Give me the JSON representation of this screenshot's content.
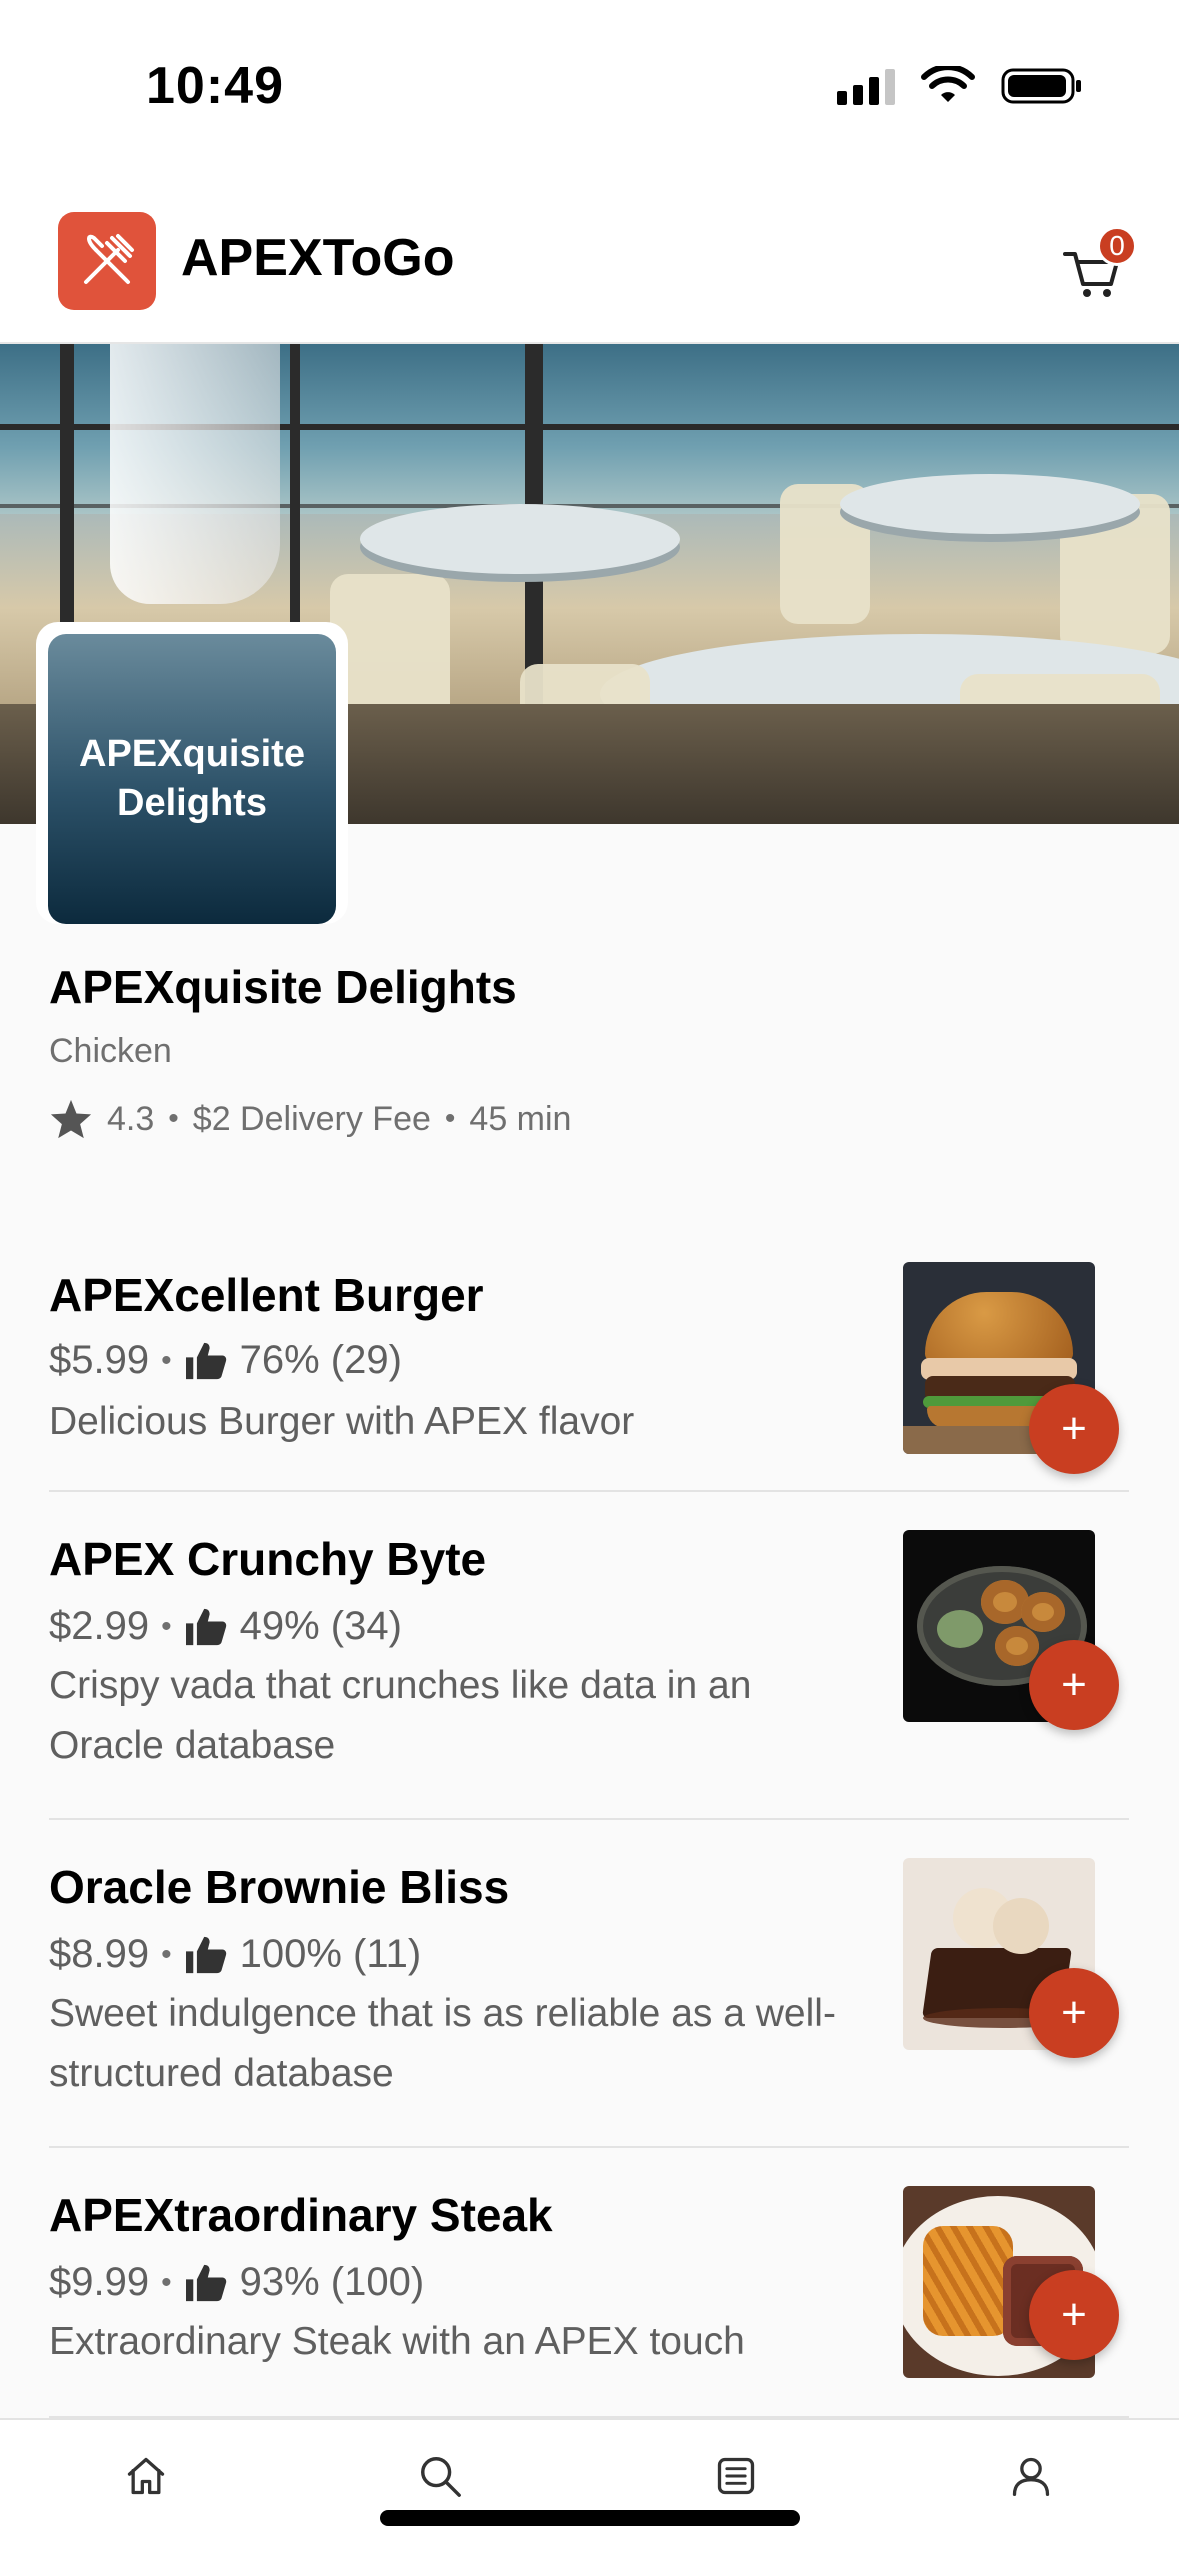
{
  "status_bar": {
    "time": "10:49"
  },
  "header": {
    "title": "APEXToGo",
    "cart_count": "0"
  },
  "restaurant": {
    "logo_text": "APEXquisite Delights",
    "name": "APEXquisite Delights",
    "category": "Chicken",
    "rating": "4.3",
    "delivery_fee": "$2 Delivery Fee",
    "delivery_time": "45 min"
  },
  "menu_items": [
    {
      "name": "APEXcellent Burger",
      "price": "$5.99",
      "rating": "76% (29)",
      "description": "Delicious Burger with APEX flavor",
      "add_label": "+",
      "image": "burger"
    },
    {
      "name": "APEX Crunchy Byte",
      "price": "$2.99",
      "rating": "49% (34)",
      "description": "Crispy vada that crunches like data in an Oracle database",
      "add_label": "+",
      "image": "vada"
    },
    {
      "name": "Oracle Brownie Bliss",
      "price": "$8.99",
      "rating": "100% (11)",
      "description": "Sweet indulgence that is as reliable as a well-structured database",
      "add_label": "+",
      "image": "brownie"
    },
    {
      "name": "APEXtraordinary Steak",
      "price": "$9.99",
      "rating": "93% (100)",
      "description": "Extraordinary Steak with an APEX touch",
      "add_label": "+",
      "image": "steak"
    }
  ],
  "bottom_nav": [
    "home-icon",
    "search-icon",
    "orders-icon",
    "profile-icon"
  ],
  "colors": {
    "accent": "#c93e21",
    "logo": "#e0533b"
  }
}
